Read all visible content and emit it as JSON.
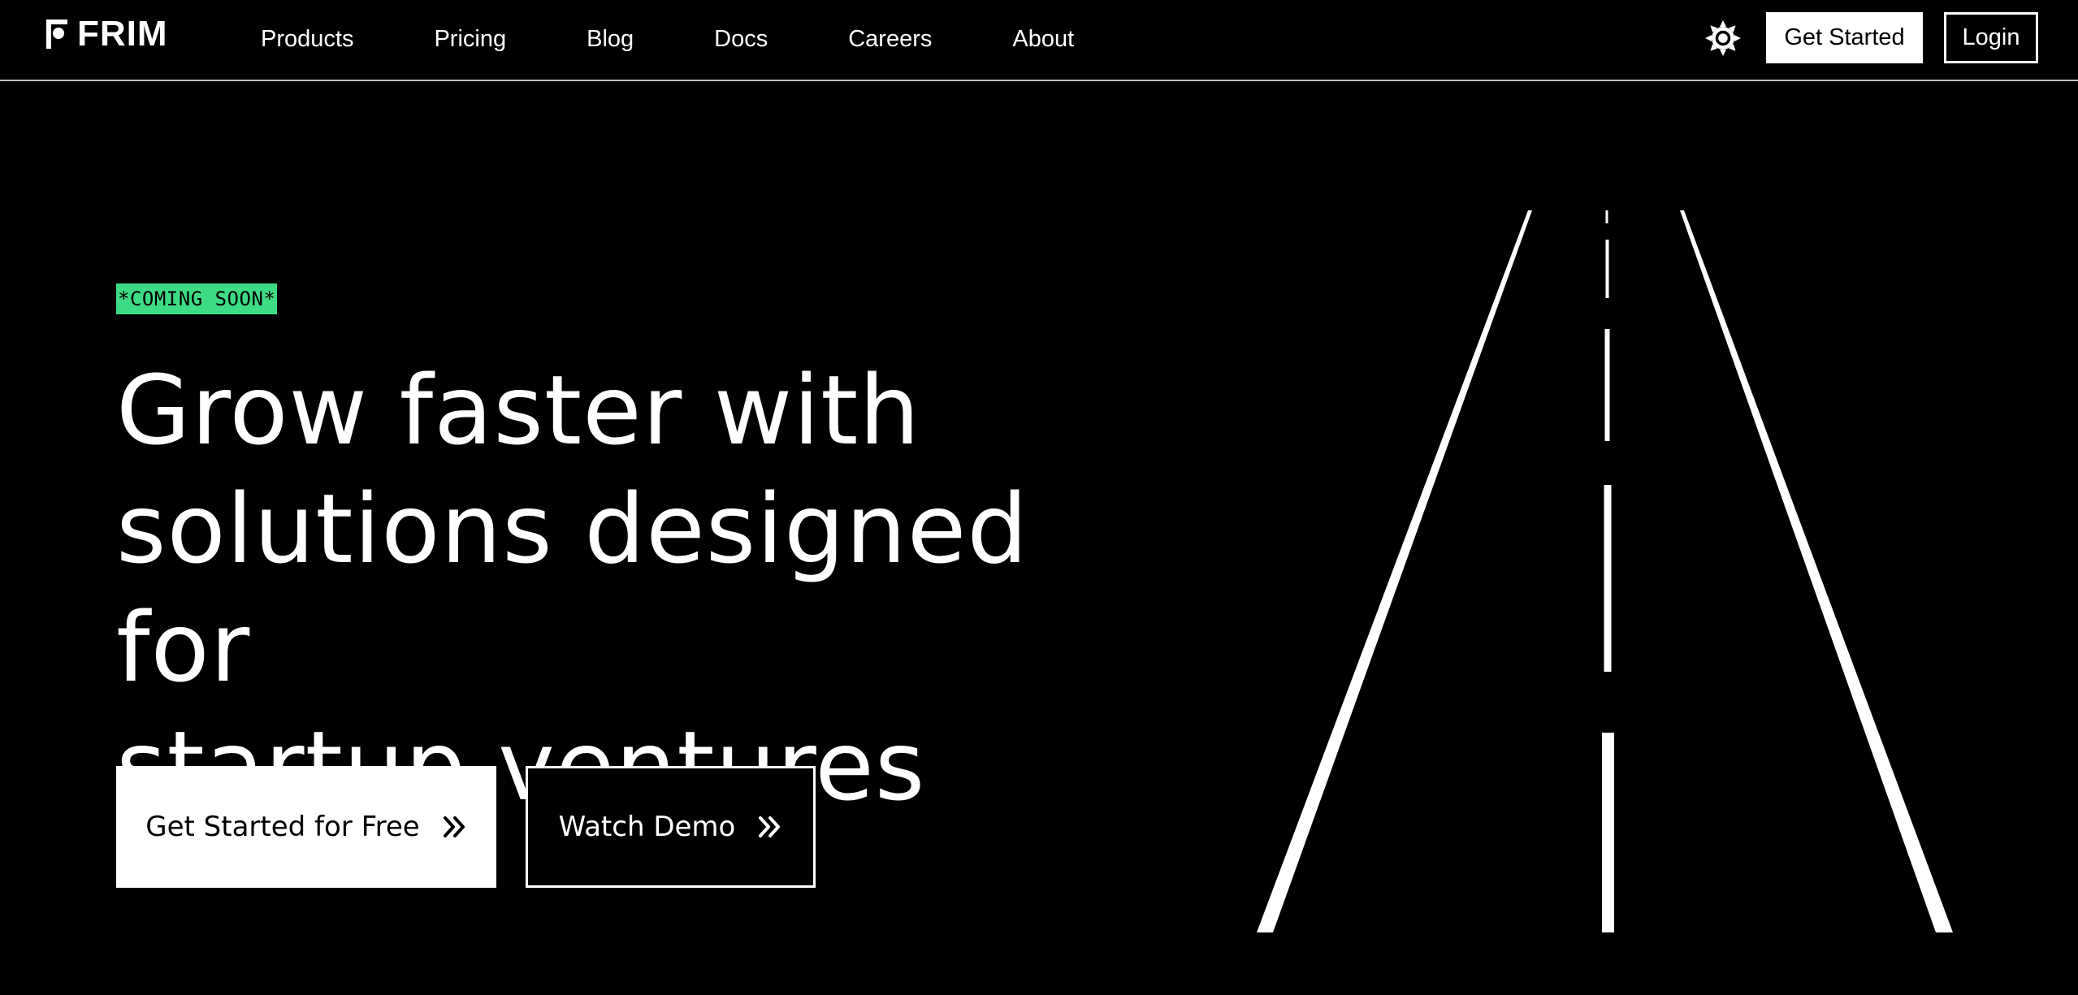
{
  "header": {
    "logo_text": "FRIM",
    "nav": [
      {
        "label": "Products"
      },
      {
        "label": "Pricing"
      },
      {
        "label": "Blog"
      },
      {
        "label": "Docs"
      },
      {
        "label": "Careers"
      },
      {
        "label": "About"
      }
    ],
    "theme_icon": "sun-icon",
    "get_started_label": "Get Started",
    "login_label": "Login"
  },
  "hero": {
    "badge": "*COMING SOON*",
    "headline_lines": [
      "Grow faster with",
      "solutions designed for",
      "startup ventures"
    ],
    "primary_cta": "Get Started for Free",
    "secondary_cta": "Watch Demo",
    "cta_icon": "double-chevron-right-icon",
    "illustration_icon": "road-illustration"
  },
  "colors": {
    "background": "#000000",
    "text": "#ffffff",
    "badge_bg": "#3ddc84",
    "badge_text": "#000000",
    "divider": "#bfbfbf"
  }
}
